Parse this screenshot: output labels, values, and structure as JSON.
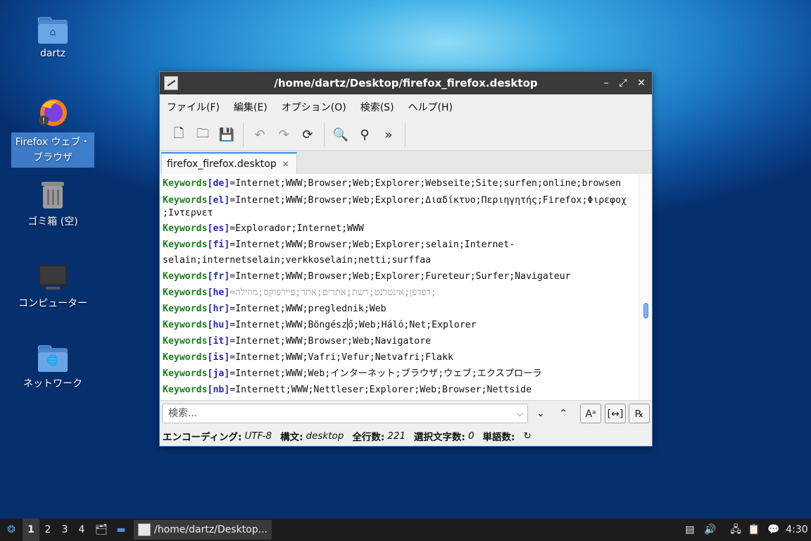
{
  "desktop": {
    "icons": [
      {
        "label": "dartz"
      },
      {
        "label_line1": "Firefox ウェブ・",
        "label_line2": "ブラウザ"
      },
      {
        "label": "ゴミ箱 (空)"
      },
      {
        "label": "コンピューター"
      },
      {
        "label": "ネットワーク"
      }
    ]
  },
  "window": {
    "title": "/home/dartz/Desktop/firefox_firefox.desktop",
    "menu": [
      "ファイル(F)",
      "編集(E)",
      "オプション(O)",
      "検索(S)",
      "ヘルプ(H)"
    ],
    "tab_label": "firefox_firefox.desktop",
    "lines": [
      {
        "key": "Keywords",
        "lang": "[de]",
        "value": "=Internet;WWW;Browser;Web;Explorer;Webseite;Site;surfen;online;browsen"
      },
      {
        "key": "Keywords",
        "lang": "[el]",
        "value": "=Internet;WWW;Browser;Web;Explorer;Διαδίκτυο;Περιηγητής;Firefox;Φιρεφοχ",
        "cont": ";Ιντερνετ"
      },
      {
        "key": "Keywords",
        "lang": "[es]",
        "value": "=Explorador;Internet;WWW"
      },
      {
        "key": "Keywords",
        "lang": "[fi]",
        "value": "=Internet;WWW;Browser;Web;Explorer;selain;Internet-",
        "cont": "selain;internetselain;verkkoselain;netti;surffaa"
      },
      {
        "key": "Keywords",
        "lang": "[fr]",
        "value": "=Internet;WWW;Browser;Web;Explorer;Fureteur;Surfer;Navigateur"
      },
      {
        "key": "Keywords",
        "lang": "[he]",
        "value": "=דפדפן;אינטרנט;רשת;אתרים;אתר;פיירפוקס;מוזילה;"
      },
      {
        "key": "Keywords",
        "lang": "[hr]",
        "value": "=Internet;WWW;preglednik;Web"
      },
      {
        "key": "Keywords",
        "lang": "[hu]",
        "value_a": "=Internet;WWW;Böngész",
        "value_b": "ő;Web;Háló;Net;Explorer"
      },
      {
        "key": "Keywords",
        "lang": "[it]",
        "value": "=Internet;WWW;Browser;Web;Navigatore"
      },
      {
        "key": "Keywords",
        "lang": "[is]",
        "value": "=Internet;WWW;Vafri;Vefur;Netvafri;Flakk"
      },
      {
        "key": "Keywords",
        "lang": "[ja]",
        "value": "=Internet;WWW;Web;インターネット;ブラウザ;ウェブ;エクスプローラ"
      },
      {
        "key": "Keywords",
        "lang": "[nb]",
        "value": "=Internett;WWW;Nettleser;Explorer;Web;Browser;Nettside"
      }
    ],
    "search": {
      "placeholder": "検索..."
    },
    "status": {
      "encoding_label": "エンコーディング:",
      "encoding_value": "UTF-8",
      "syntax_label": "構文:",
      "syntax_value": "desktop",
      "lines_label": "全行数:",
      "lines_value": "221",
      "selected_label": "選択文字数:",
      "selected_value": "0",
      "words_label": "単語数:"
    }
  },
  "taskbar": {
    "workspaces": [
      "1",
      "2",
      "3",
      "4"
    ],
    "task_label": "/home/dartz/Desktop...",
    "clock": "4:30"
  }
}
